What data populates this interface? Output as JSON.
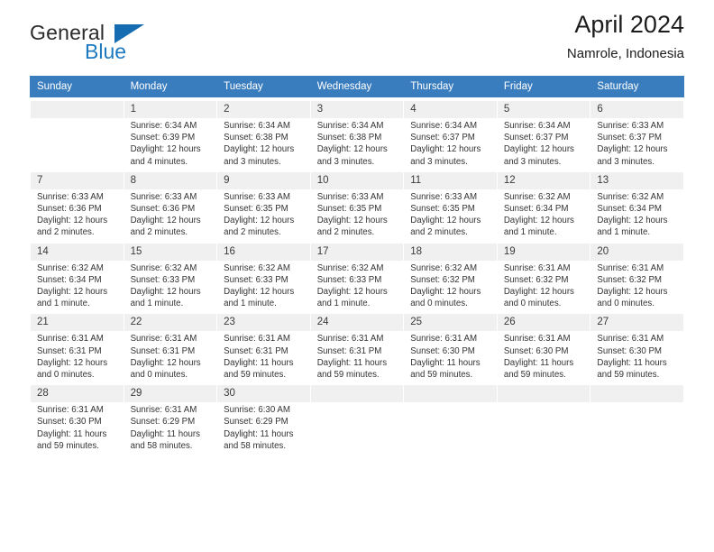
{
  "brand": {
    "name_top": "General",
    "name_bottom": "Blue",
    "triangle_icon": "blue-triangle-logo-mark"
  },
  "header": {
    "title": "April 2024",
    "subtitle": "Namrole, Indonesia"
  },
  "colors": {
    "header_blue": "#3a7dbf",
    "brand_blue": "#1e7ac0",
    "daynum_bg": "#f0f0f0",
    "row_divider": "#b6b6b6"
  },
  "calendar": {
    "weekday_headers": [
      "Sunday",
      "Monday",
      "Tuesday",
      "Wednesday",
      "Thursday",
      "Friday",
      "Saturday"
    ],
    "weeks": [
      [
        {
          "day": "",
          "lines": []
        },
        {
          "day": "1",
          "lines": [
            "Sunrise: 6:34 AM",
            "Sunset: 6:39 PM",
            "Daylight: 12 hours",
            "and 4 minutes."
          ]
        },
        {
          "day": "2",
          "lines": [
            "Sunrise: 6:34 AM",
            "Sunset: 6:38 PM",
            "Daylight: 12 hours",
            "and 3 minutes."
          ]
        },
        {
          "day": "3",
          "lines": [
            "Sunrise: 6:34 AM",
            "Sunset: 6:38 PM",
            "Daylight: 12 hours",
            "and 3 minutes."
          ]
        },
        {
          "day": "4",
          "lines": [
            "Sunrise: 6:34 AM",
            "Sunset: 6:37 PM",
            "Daylight: 12 hours",
            "and 3 minutes."
          ]
        },
        {
          "day": "5",
          "lines": [
            "Sunrise: 6:34 AM",
            "Sunset: 6:37 PM",
            "Daylight: 12 hours",
            "and 3 minutes."
          ]
        },
        {
          "day": "6",
          "lines": [
            "Sunrise: 6:33 AM",
            "Sunset: 6:37 PM",
            "Daylight: 12 hours",
            "and 3 minutes."
          ]
        }
      ],
      [
        {
          "day": "7",
          "lines": [
            "Sunrise: 6:33 AM",
            "Sunset: 6:36 PM",
            "Daylight: 12 hours",
            "and 2 minutes."
          ]
        },
        {
          "day": "8",
          "lines": [
            "Sunrise: 6:33 AM",
            "Sunset: 6:36 PM",
            "Daylight: 12 hours",
            "and 2 minutes."
          ]
        },
        {
          "day": "9",
          "lines": [
            "Sunrise: 6:33 AM",
            "Sunset: 6:35 PM",
            "Daylight: 12 hours",
            "and 2 minutes."
          ]
        },
        {
          "day": "10",
          "lines": [
            "Sunrise: 6:33 AM",
            "Sunset: 6:35 PM",
            "Daylight: 12 hours",
            "and 2 minutes."
          ]
        },
        {
          "day": "11",
          "lines": [
            "Sunrise: 6:33 AM",
            "Sunset: 6:35 PM",
            "Daylight: 12 hours",
            "and 2 minutes."
          ]
        },
        {
          "day": "12",
          "lines": [
            "Sunrise: 6:32 AM",
            "Sunset: 6:34 PM",
            "Daylight: 12 hours",
            "and 1 minute."
          ]
        },
        {
          "day": "13",
          "lines": [
            "Sunrise: 6:32 AM",
            "Sunset: 6:34 PM",
            "Daylight: 12 hours",
            "and 1 minute."
          ]
        }
      ],
      [
        {
          "day": "14",
          "lines": [
            "Sunrise: 6:32 AM",
            "Sunset: 6:34 PM",
            "Daylight: 12 hours",
            "and 1 minute."
          ]
        },
        {
          "day": "15",
          "lines": [
            "Sunrise: 6:32 AM",
            "Sunset: 6:33 PM",
            "Daylight: 12 hours",
            "and 1 minute."
          ]
        },
        {
          "day": "16",
          "lines": [
            "Sunrise: 6:32 AM",
            "Sunset: 6:33 PM",
            "Daylight: 12 hours",
            "and 1 minute."
          ]
        },
        {
          "day": "17",
          "lines": [
            "Sunrise: 6:32 AM",
            "Sunset: 6:33 PM",
            "Daylight: 12 hours",
            "and 1 minute."
          ]
        },
        {
          "day": "18",
          "lines": [
            "Sunrise: 6:32 AM",
            "Sunset: 6:32 PM",
            "Daylight: 12 hours",
            "and 0 minutes."
          ]
        },
        {
          "day": "19",
          "lines": [
            "Sunrise: 6:31 AM",
            "Sunset: 6:32 PM",
            "Daylight: 12 hours",
            "and 0 minutes."
          ]
        },
        {
          "day": "20",
          "lines": [
            "Sunrise: 6:31 AM",
            "Sunset: 6:32 PM",
            "Daylight: 12 hours",
            "and 0 minutes."
          ]
        }
      ],
      [
        {
          "day": "21",
          "lines": [
            "Sunrise: 6:31 AM",
            "Sunset: 6:31 PM",
            "Daylight: 12 hours",
            "and 0 minutes."
          ]
        },
        {
          "day": "22",
          "lines": [
            "Sunrise: 6:31 AM",
            "Sunset: 6:31 PM",
            "Daylight: 12 hours",
            "and 0 minutes."
          ]
        },
        {
          "day": "23",
          "lines": [
            "Sunrise: 6:31 AM",
            "Sunset: 6:31 PM",
            "Daylight: 11 hours",
            "and 59 minutes."
          ]
        },
        {
          "day": "24",
          "lines": [
            "Sunrise: 6:31 AM",
            "Sunset: 6:31 PM",
            "Daylight: 11 hours",
            "and 59 minutes."
          ]
        },
        {
          "day": "25",
          "lines": [
            "Sunrise: 6:31 AM",
            "Sunset: 6:30 PM",
            "Daylight: 11 hours",
            "and 59 minutes."
          ]
        },
        {
          "day": "26",
          "lines": [
            "Sunrise: 6:31 AM",
            "Sunset: 6:30 PM",
            "Daylight: 11 hours",
            "and 59 minutes."
          ]
        },
        {
          "day": "27",
          "lines": [
            "Sunrise: 6:31 AM",
            "Sunset: 6:30 PM",
            "Daylight: 11 hours",
            "and 59 minutes."
          ]
        }
      ],
      [
        {
          "day": "28",
          "lines": [
            "Sunrise: 6:31 AM",
            "Sunset: 6:30 PM",
            "Daylight: 11 hours",
            "and 59 minutes."
          ]
        },
        {
          "day": "29",
          "lines": [
            "Sunrise: 6:31 AM",
            "Sunset: 6:29 PM",
            "Daylight: 11 hours",
            "and 58 minutes."
          ]
        },
        {
          "day": "30",
          "lines": [
            "Sunrise: 6:30 AM",
            "Sunset: 6:29 PM",
            "Daylight: 11 hours",
            "and 58 minutes."
          ]
        },
        {
          "day": "",
          "lines": []
        },
        {
          "day": "",
          "lines": []
        },
        {
          "day": "",
          "lines": []
        },
        {
          "day": "",
          "lines": []
        }
      ]
    ]
  }
}
